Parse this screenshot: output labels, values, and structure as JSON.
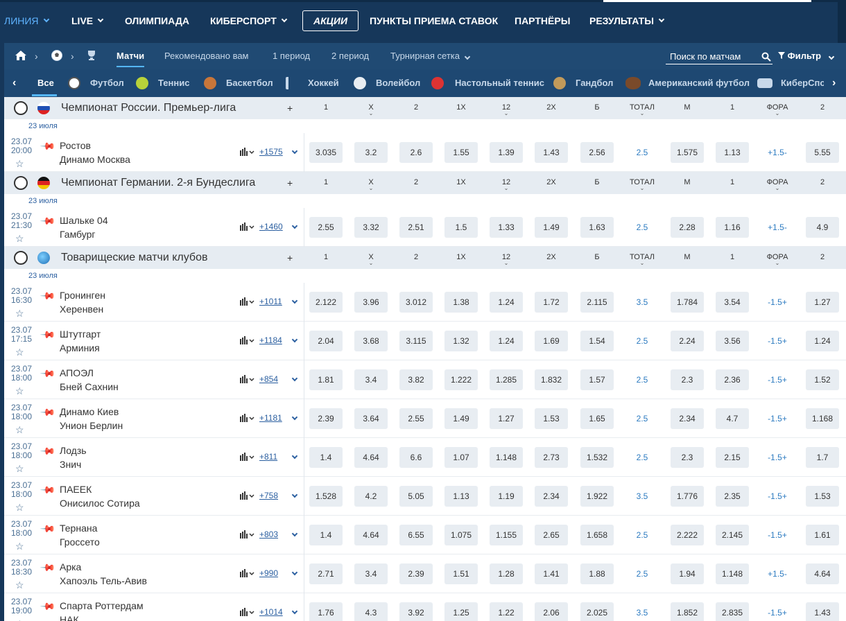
{
  "nav": {
    "items": [
      {
        "label": "ЛИНИЯ",
        "active": true,
        "chevron": true
      },
      {
        "label": "LIVE",
        "active": false,
        "chevron": true
      },
      {
        "label": "ОЛИМПИАДА",
        "active": false,
        "chevron": false
      },
      {
        "label": "КИБЕРСПОРТ",
        "active": false,
        "chevron": true
      },
      {
        "label": "АКЦИИ",
        "active": false,
        "chevron": false
      },
      {
        "label": "ПУНКТЫ ПРИЕМА СТАВОК",
        "active": false,
        "chevron": false
      },
      {
        "label": "ПАРТНЁРЫ",
        "active": false,
        "chevron": false
      },
      {
        "label": "РЕЗУЛЬТАТЫ",
        "active": false,
        "chevron": true
      }
    ]
  },
  "subnav": {
    "tabs": [
      "Матчи",
      "Рекомендовано вам",
      "1 период",
      "2 период",
      "Турнирная сетка"
    ],
    "search_placeholder": "Поиск по матчам",
    "filter_label": "Фильтр"
  },
  "sports": [
    "Все",
    "Футбол",
    "Теннис",
    "Баскетбол",
    "Хоккей",
    "Волейбол",
    "Настольный теннис",
    "Гандбол",
    "Американский футбол",
    "КиберСпорт"
  ],
  "column_headers": [
    "1",
    "X",
    "2",
    "1X",
    "12",
    "2X",
    "Б",
    "ТОТАЛ",
    "М",
    "1",
    "ФОРА",
    "2"
  ],
  "leagues": [
    {
      "title": "Чемпионат России. Премьер-лига",
      "date": "23 июля",
      "matches": [
        {
          "date": "23.07",
          "time": "20:00",
          "team1": "Ростов",
          "team2": "Динамо Москва",
          "count": "+1575",
          "odds": [
            "3.035",
            "3.2",
            "2.6",
            "1.55",
            "1.39",
            "1.43",
            "2.56",
            "2.5",
            "1.575",
            "1.13",
            "+1.5-",
            "5.55"
          ]
        }
      ]
    },
    {
      "title": "Чемпионат Германии. 2-я Бундеслига",
      "date": "23 июля",
      "matches": [
        {
          "date": "23.07",
          "time": "21:30",
          "team1": "Шальке 04",
          "team2": "Гамбург",
          "count": "+1460",
          "odds": [
            "2.55",
            "3.32",
            "2.51",
            "1.5",
            "1.33",
            "1.49",
            "1.63",
            "2.5",
            "2.28",
            "1.16",
            "+1.5-",
            "4.9"
          ]
        }
      ]
    },
    {
      "title": "Товарищеские матчи клубов",
      "date": "23 июля",
      "matches": [
        {
          "date": "23.07",
          "time": "16:30",
          "team1": "Гронинген",
          "team2": "Херенвен",
          "count": "+1011",
          "odds": [
            "2.122",
            "3.96",
            "3.012",
            "1.38",
            "1.24",
            "1.72",
            "2.115",
            "3.5",
            "1.784",
            "3.54",
            "-1.5+",
            "1.27"
          ]
        },
        {
          "date": "23.07",
          "time": "17:15",
          "team1": "Штутгарт",
          "team2": "Арминия",
          "count": "+1184",
          "odds": [
            "2.04",
            "3.68",
            "3.115",
            "1.32",
            "1.24",
            "1.69",
            "1.54",
            "2.5",
            "2.24",
            "3.56",
            "-1.5+",
            "1.24"
          ]
        },
        {
          "date": "23.07",
          "time": "18:00",
          "team1": "АПОЭЛ",
          "team2": "Бней Сахнин",
          "count": "+854",
          "odds": [
            "1.81",
            "3.4",
            "3.82",
            "1.222",
            "1.285",
            "1.832",
            "1.57",
            "2.5",
            "2.3",
            "2.36",
            "-1.5+",
            "1.52"
          ]
        },
        {
          "date": "23.07",
          "time": "18:00",
          "team1": "Динамо Киев",
          "team2": "Унион Берлин",
          "count": "+1181",
          "odds": [
            "2.39",
            "3.64",
            "2.55",
            "1.49",
            "1.27",
            "1.53",
            "1.65",
            "2.5",
            "2.34",
            "4.7",
            "-1.5+",
            "1.168"
          ]
        },
        {
          "date": "23.07",
          "time": "18:00",
          "team1": "Лодзь",
          "team2": "Знич",
          "count": "+811",
          "odds": [
            "1.4",
            "4.64",
            "6.6",
            "1.07",
            "1.148",
            "2.73",
            "1.532",
            "2.5",
            "2.3",
            "2.15",
            "-1.5+",
            "1.7"
          ]
        },
        {
          "date": "23.07",
          "time": "18:00",
          "team1": "ПАЕЕК",
          "team2": "Онисилос Сотира",
          "count": "+758",
          "odds": [
            "1.528",
            "4.2",
            "5.05",
            "1.13",
            "1.19",
            "2.34",
            "1.922",
            "3.5",
            "1.776",
            "2.35",
            "-1.5+",
            "1.53"
          ]
        },
        {
          "date": "23.07",
          "time": "18:00",
          "team1": "Тернана",
          "team2": "Гроссето",
          "count": "+803",
          "odds": [
            "1.4",
            "4.64",
            "6.55",
            "1.075",
            "1.155",
            "2.65",
            "1.658",
            "2.5",
            "2.222",
            "2.145",
            "-1.5+",
            "1.61"
          ]
        },
        {
          "date": "23.07",
          "time": "18:30",
          "team1": "Арка",
          "team2": "Хапоэль Тель-Авив",
          "count": "+990",
          "odds": [
            "2.71",
            "3.4",
            "2.39",
            "1.51",
            "1.28",
            "1.41",
            "1.88",
            "2.5",
            "1.94",
            "1.148",
            "+1.5-",
            "4.64"
          ]
        },
        {
          "date": "23.07",
          "time": "19:00",
          "team1": "Спарта Роттердам",
          "team2": "НАК",
          "count": "+1014",
          "odds": [
            "1.76",
            "4.3",
            "3.92",
            "1.25",
            "1.22",
            "2.06",
            "2.025",
            "3.5",
            "1.852",
            "2.835",
            "-1.5+",
            "1.43"
          ]
        }
      ]
    }
  ]
}
